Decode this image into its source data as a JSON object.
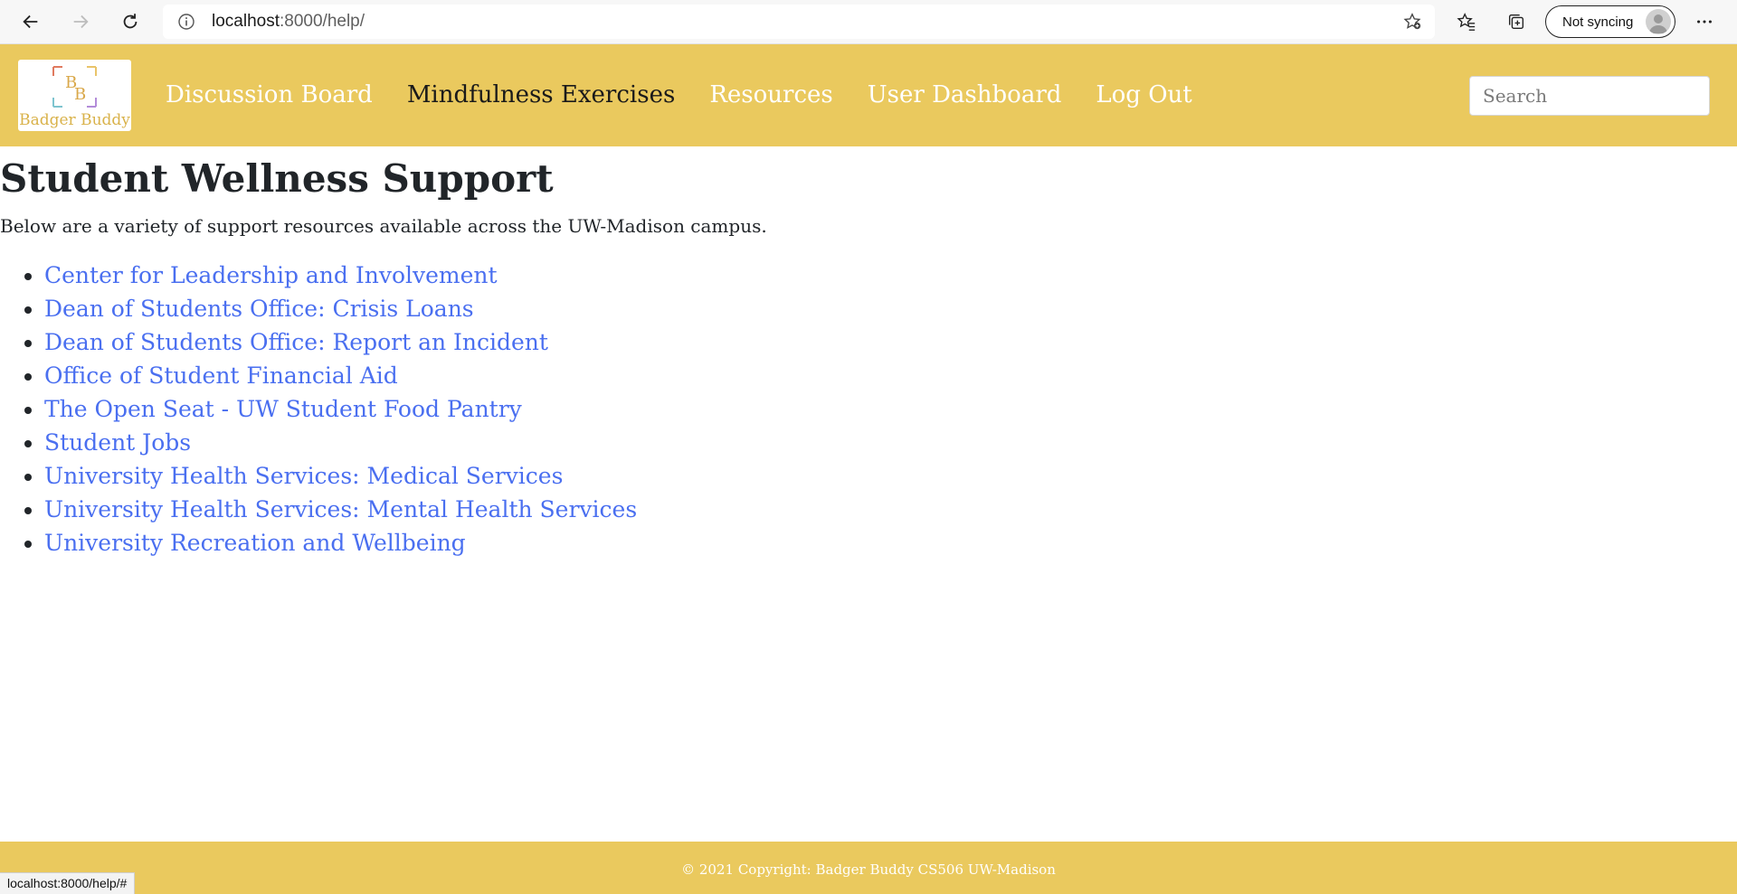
{
  "browser": {
    "url_host": "localhost",
    "url_path": ":8000/help/",
    "sync_label": "Not syncing",
    "status_url": "localhost:8000/help/#"
  },
  "navbar": {
    "logo_text": "Badger Buddy",
    "links": [
      {
        "label": "Discussion Board",
        "active": false
      },
      {
        "label": "Mindfulness Exercises",
        "active": true
      },
      {
        "label": "Resources",
        "active": false
      },
      {
        "label": "User Dashboard",
        "active": false
      },
      {
        "label": "Log Out",
        "active": false
      }
    ],
    "search_placeholder": "Search"
  },
  "main": {
    "title": "Student Wellness Support",
    "intro": "Below are a variety of support resources available across the UW-Madison campus.",
    "resources": [
      "Center for Leadership and Involvement",
      "Dean of Students Office: Crisis Loans",
      "Dean of Students Office: Report an Incident",
      "Office of Student Financial Aid",
      "The Open Seat - UW Student Food Pantry",
      "Student Jobs",
      "University Health Services: Medical Services",
      "University Health Services: Mental Health Services",
      "University Recreation and Wellbeing"
    ]
  },
  "footer": {
    "text": "© 2021 Copyright: Badger Buddy CS506 UW-Madison"
  },
  "colors": {
    "brand": "#eac95e",
    "link": "#4a6ff0",
    "nav_text": "#ffffff",
    "nav_active": "#1a1a1a"
  }
}
